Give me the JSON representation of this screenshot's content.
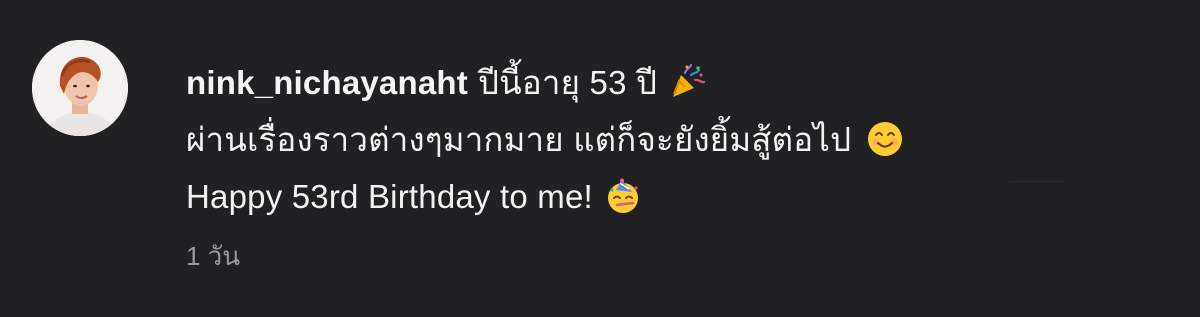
{
  "comment": {
    "username": "nink_nichayanaht",
    "line1_text": "ปีนี้อายุ 53 ปี",
    "line1_emoji": "party-popper-icon",
    "line2_text": "ผ่านเรื่องราวต่างๆมากมาย แต่ก็จะยังยิ้มสู้ต่อไป",
    "line2_emoji": "smiling-face-icon",
    "line3_text": "Happy 53rd Birthday to me!",
    "line3_emoji": "partying-face-icon",
    "timestamp": "1 วัน"
  },
  "colors": {
    "background": "#212124",
    "text": "#f2f2f2",
    "meta_text": "#9a9a9a"
  }
}
